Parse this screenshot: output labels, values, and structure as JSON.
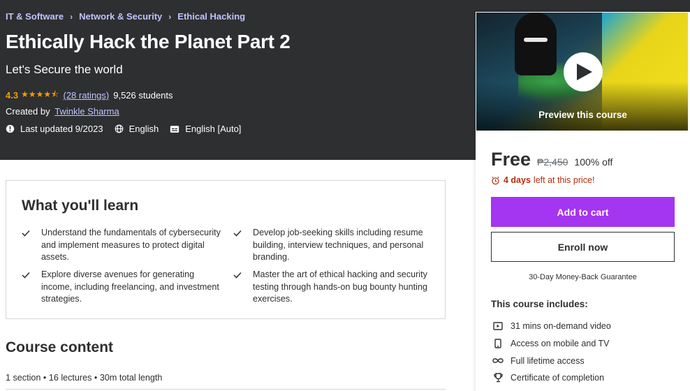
{
  "breadcrumb": [
    "IT & Software",
    "Network & Security",
    "Ethical Hacking"
  ],
  "course": {
    "title": "Ethically Hack the Planet Part 2",
    "subtitle": "Let's Secure the world",
    "rating": "4.3",
    "stars_value": 4.3,
    "ratings_link": "(28 ratings)",
    "students": "9,526 students",
    "created_by_label": "Created by",
    "instructor": "Twinkle Sharma",
    "last_updated": "Last updated 9/2023",
    "language": "English",
    "captions": "English [Auto]"
  },
  "sidebar": {
    "preview_label": "Preview this course",
    "price_free": "Free",
    "price_original": "₱2,450",
    "discount": "100% off",
    "timer_bold": "4 days",
    "timer_rest": "left at this price!",
    "add_to_cart": "Add to cart",
    "enroll_now": "Enroll now",
    "guarantee": "30-Day Money-Back Guarantee",
    "includes_title": "This course includes:",
    "includes": [
      {
        "icon": "video-icon",
        "text": "31 mins on-demand video"
      },
      {
        "icon": "mobile-icon",
        "text": "Access on mobile and TV"
      },
      {
        "icon": "infinity-icon",
        "text": "Full lifetime access"
      },
      {
        "icon": "trophy-icon",
        "text": "Certificate of completion"
      }
    ]
  },
  "learn": {
    "title": "What you'll learn",
    "items": [
      "Understand the fundamentals of cybersecurity and implement measures to protect digital assets.",
      "Develop job-seeking skills including resume building, interview techniques, and personal branding.",
      "Explore diverse avenues for generating income, including freelancing, and investment strategies.",
      "Master the art of ethical hacking and security testing through hands-on bug bounty hunting exercises."
    ]
  },
  "content": {
    "title": "Course content",
    "meta": "1 section • 16 lectures • 30m total length"
  },
  "colors": {
    "hero_bg": "#2d2f31",
    "accent_purple": "#a435f0",
    "link_lavender": "#c0c4fc",
    "star_orange": "#f69c08",
    "timer_red": "#b32d0f"
  }
}
